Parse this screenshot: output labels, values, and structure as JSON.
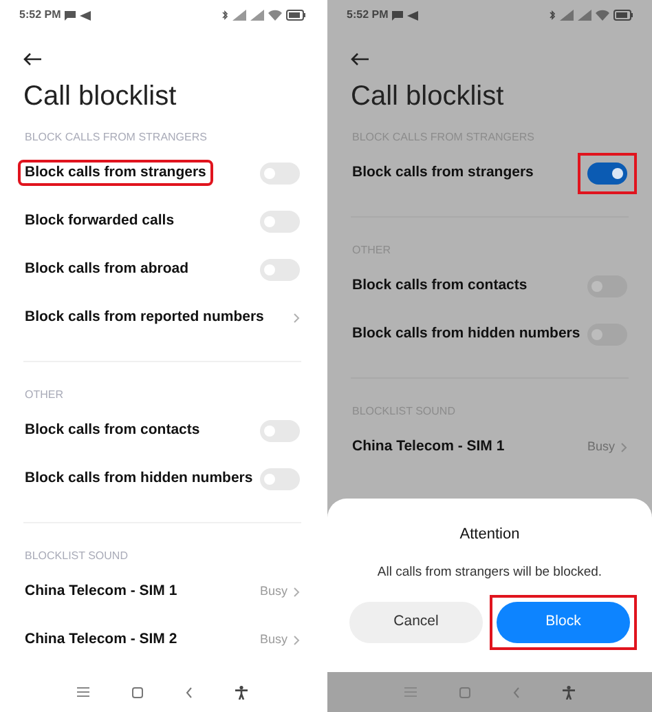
{
  "screens": [
    {
      "status_bar": {
        "time": "5:52 PM"
      },
      "title": "Call blocklist",
      "sections": [
        {
          "header": "BLOCK CALLS FROM STRANGERS",
          "rows": [
            {
              "kind": "toggle",
              "label": "Block calls from strangers",
              "on": false,
              "label_highlighted": true,
              "switch_highlighted": false
            },
            {
              "kind": "toggle",
              "label": "Block forwarded calls",
              "on": false,
              "label_highlighted": false,
              "switch_highlighted": false
            },
            {
              "kind": "toggle",
              "label": "Block calls from abroad",
              "on": false,
              "label_highlighted": false,
              "switch_highlighted": false
            },
            {
              "kind": "link",
              "label": "Block calls from reported numbers",
              "label_highlighted": false
            }
          ]
        },
        {
          "header": "OTHER",
          "rows": [
            {
              "kind": "toggle",
              "label": "Block calls from contacts",
              "on": false,
              "label_highlighted": false,
              "switch_highlighted": false
            },
            {
              "kind": "toggle",
              "label": "Block calls from hidden numbers",
              "on": false,
              "label_highlighted": false,
              "switch_highlighted": false
            }
          ]
        },
        {
          "header": "BLOCKLIST SOUND",
          "rows": [
            {
              "kind": "link",
              "label": "China Telecom - SIM 1",
              "value": "Busy",
              "label_highlighted": false
            },
            {
              "kind": "link",
              "label": "China Telecom - SIM 2",
              "value": "Busy",
              "label_highlighted": false
            }
          ]
        }
      ]
    },
    {
      "status_bar": {
        "time": "5:52 PM"
      },
      "title": "Call blocklist",
      "sections": [
        {
          "header": "BLOCK CALLS FROM STRANGERS",
          "rows": [
            {
              "kind": "toggle",
              "label": "Block calls from strangers",
              "on": true,
              "label_highlighted": false,
              "switch_highlighted": true
            }
          ]
        },
        {
          "header": "OTHER",
          "rows": [
            {
              "kind": "toggle",
              "label": "Block calls from contacts",
              "on": false,
              "label_highlighted": false,
              "switch_highlighted": false
            },
            {
              "kind": "toggle",
              "label": "Block calls from hidden numbers",
              "on": false,
              "label_highlighted": false,
              "switch_highlighted": false
            }
          ]
        },
        {
          "header": "BLOCKLIST SOUND",
          "rows": [
            {
              "kind": "link",
              "label": "China Telecom - SIM 1",
              "value": "Busy",
              "label_highlighted": false
            }
          ]
        }
      ],
      "dialog": {
        "title": "Attention",
        "message": "All calls from strangers will be blocked.",
        "buttons": [
          {
            "kind": "secondary",
            "label": "Cancel",
            "highlighted": false
          },
          {
            "kind": "primary",
            "label": "Block",
            "highlighted": true
          }
        ]
      }
    }
  ]
}
